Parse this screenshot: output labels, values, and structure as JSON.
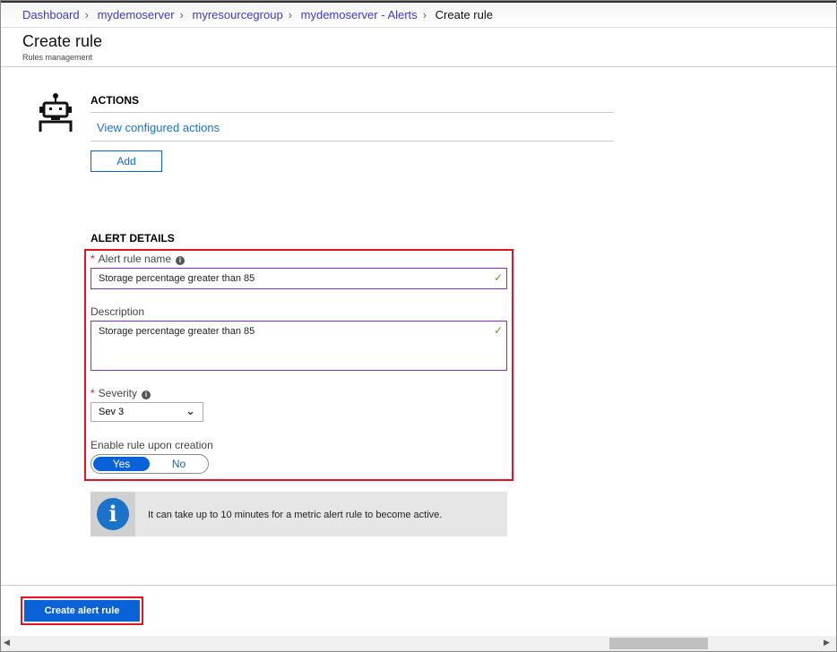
{
  "breadcrumb": [
    "Dashboard",
    "mydemoserver",
    "myresourcegroup",
    "mydemoserver - Alerts",
    "Create rule"
  ],
  "header": {
    "title": "Create rule",
    "subtitle": "Rules management"
  },
  "actions": {
    "heading": "ACTIONS",
    "link": "View configured actions",
    "add": "Add"
  },
  "details": {
    "heading": "ALERT DETAILS",
    "name_label": "Alert rule name",
    "name_value": "Storage percentage greater than 85",
    "desc_label": "Description",
    "desc_value": "Storage percentage greater than 85",
    "severity_label": "Severity",
    "severity_value": "Sev 3",
    "enable_label": "Enable rule upon creation",
    "yes": "Yes",
    "no": "No"
  },
  "info": "It can take up to 10 minutes for a metric alert rule to become active.",
  "footer": {
    "create": "Create alert rule"
  }
}
